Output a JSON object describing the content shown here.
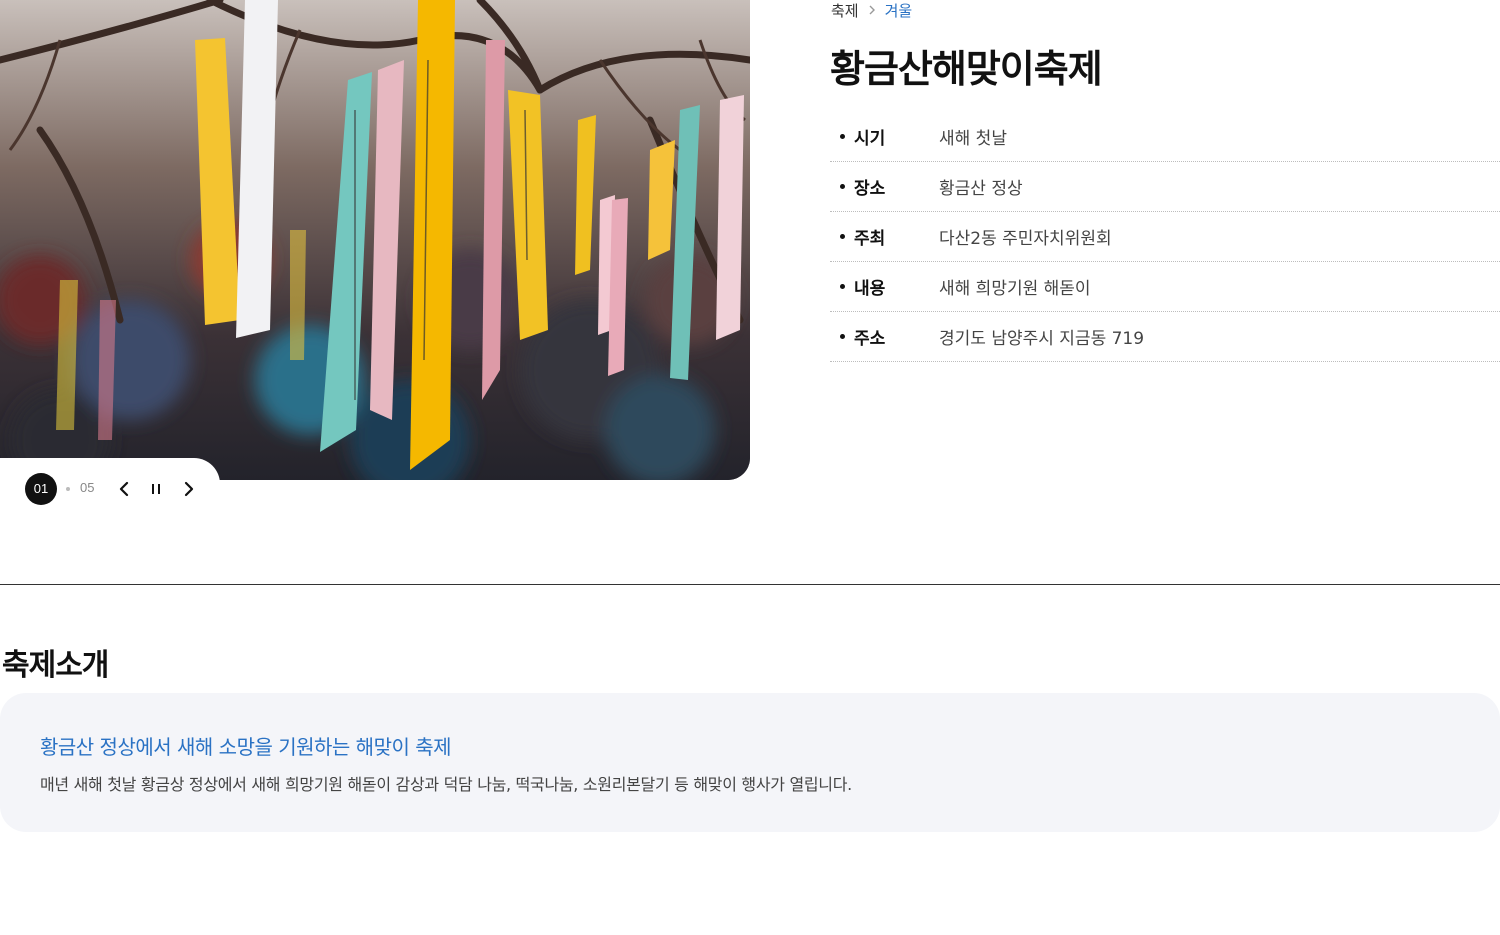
{
  "breadcrumb": {
    "parent": "축제",
    "current": "겨울"
  },
  "festival": {
    "title": "황금산해맞이축제",
    "info": [
      {
        "label": "시기",
        "value": "새해 첫날"
      },
      {
        "label": "장소",
        "value": "황금산 정상"
      },
      {
        "label": "주최",
        "value": "다산2동 주민자치위원회"
      },
      {
        "label": "내용",
        "value": "새해 희망기원 해돋이"
      },
      {
        "label": "주소",
        "value": "경기도 남양주시 지금동 719"
      }
    ]
  },
  "slider": {
    "current": "01",
    "total": "05",
    "icons": {
      "prev": "chevron-left-icon",
      "pause": "pause-icon",
      "next": "chevron-right-icon"
    }
  },
  "intro": {
    "section_title": "축제소개",
    "heading": "황금산 정상에서 새해 소망을 기원하는 해맞이 축제",
    "text": "매년 새해 첫날 황금상 정상에서 새해 희망기원 해돋이 감상과 덕담 나눔, 떡국나눔, 소원리본달기 등 해맞이 행사가 열립니다."
  },
  "colors": {
    "accent": "#2a72c4",
    "box_background": "#f4f5f9",
    "ribbon_yellow": "#f4c430"
  }
}
